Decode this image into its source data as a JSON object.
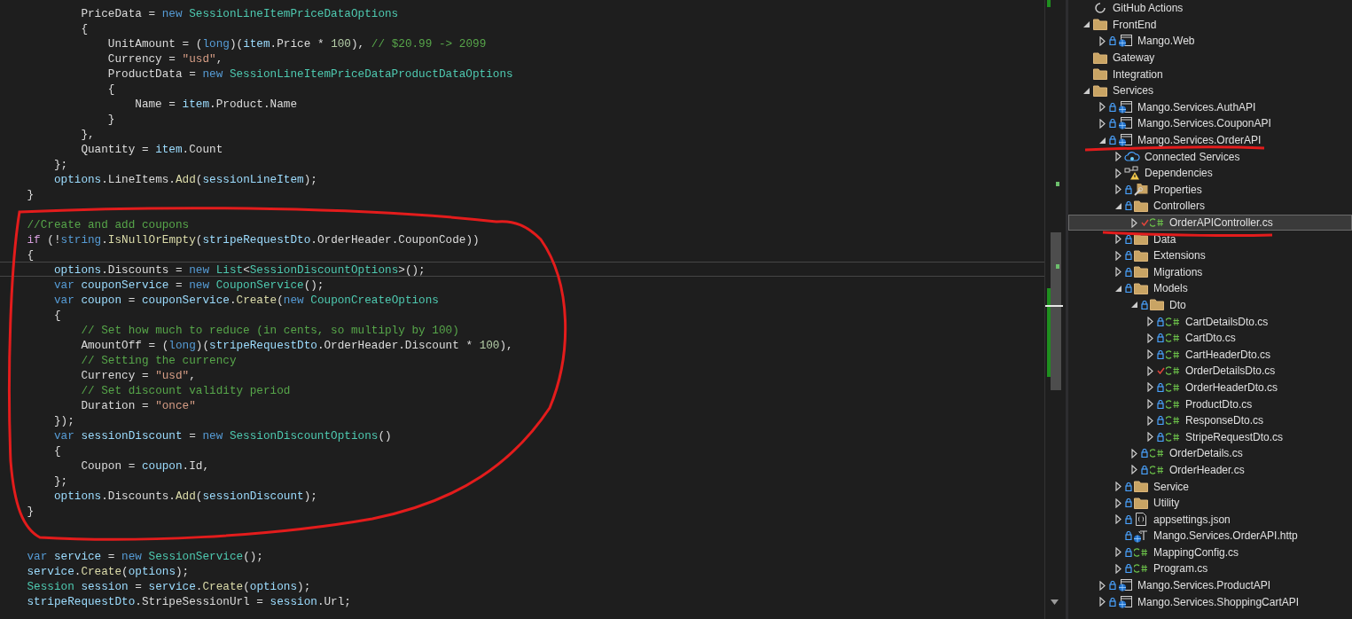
{
  "editor": {
    "lines": [
      {
        "kind": "code",
        "tokens": [
          {
            "kind": "plain",
            "text": "            PriceData = "
          },
          {
            "kind": "keyword",
            "text": "new"
          },
          {
            "kind": "type",
            "text": " SessionLineItemPriceDataOptions"
          }
        ]
      },
      {
        "kind": "code",
        "tokens": [
          {
            "kind": "plain",
            "text": "            {"
          }
        ]
      },
      {
        "kind": "code",
        "tokens": [
          {
            "kind": "plain",
            "text": "                UnitAmount = ("
          },
          {
            "kind": "keyword",
            "text": "long"
          },
          {
            "kind": "plain",
            "text": ")("
          },
          {
            "kind": "variable",
            "text": "item"
          },
          {
            "kind": "plain",
            "text": ".Price * "
          },
          {
            "kind": "number",
            "text": "100"
          },
          {
            "kind": "plain",
            "text": "), "
          },
          {
            "kind": "comment",
            "text": "// $20.99 -> 2099"
          }
        ]
      },
      {
        "kind": "code",
        "tokens": [
          {
            "kind": "plain",
            "text": "                Currency = "
          },
          {
            "kind": "string",
            "text": "\"usd\""
          },
          {
            "kind": "plain",
            "text": ","
          }
        ]
      },
      {
        "kind": "code",
        "tokens": [
          {
            "kind": "plain",
            "text": "                ProductData = "
          },
          {
            "kind": "keyword",
            "text": "new"
          },
          {
            "kind": "type",
            "text": " SessionLineItemPriceDataProductDataOptions"
          }
        ]
      },
      {
        "kind": "code",
        "tokens": [
          {
            "kind": "plain",
            "text": "                {"
          }
        ]
      },
      {
        "kind": "code",
        "tokens": [
          {
            "kind": "plain",
            "text": "                    Name = "
          },
          {
            "kind": "variable",
            "text": "item"
          },
          {
            "kind": "plain",
            "text": ".Product.Name"
          }
        ]
      },
      {
        "kind": "code",
        "tokens": [
          {
            "kind": "plain",
            "text": "                }"
          }
        ]
      },
      {
        "kind": "code",
        "tokens": [
          {
            "kind": "plain",
            "text": "            },"
          }
        ]
      },
      {
        "kind": "code",
        "tokens": [
          {
            "kind": "plain",
            "text": "            Quantity = "
          },
          {
            "kind": "variable",
            "text": "item"
          },
          {
            "kind": "plain",
            "text": ".Count"
          }
        ]
      },
      {
        "kind": "code",
        "tokens": [
          {
            "kind": "plain",
            "text": "        };"
          }
        ]
      },
      {
        "kind": "code",
        "tokens": [
          {
            "kind": "variable",
            "text": "        options"
          },
          {
            "kind": "plain",
            "text": ".LineItems."
          },
          {
            "kind": "method",
            "text": "Add"
          },
          {
            "kind": "plain",
            "text": "("
          },
          {
            "kind": "variable",
            "text": "sessionLineItem"
          },
          {
            "kind": "plain",
            "text": ");"
          }
        ]
      },
      {
        "kind": "code",
        "tokens": [
          {
            "kind": "plain",
            "text": "    }"
          }
        ]
      },
      {
        "kind": "blank"
      },
      {
        "kind": "code",
        "tokens": [
          {
            "kind": "comment",
            "text": "    //Create and add coupons"
          }
        ]
      },
      {
        "kind": "code",
        "tokens": [
          {
            "kind": "control",
            "text": "    if"
          },
          {
            "kind": "plain",
            "text": " (!"
          },
          {
            "kind": "keyword",
            "text": "string"
          },
          {
            "kind": "plain",
            "text": "."
          },
          {
            "kind": "method",
            "text": "IsNullOrEmpty"
          },
          {
            "kind": "plain",
            "text": "("
          },
          {
            "kind": "variable",
            "text": "stripeRequestDto"
          },
          {
            "kind": "plain",
            "text": ".OrderHeader.CouponCode))"
          }
        ]
      },
      {
        "kind": "code",
        "tokens": [
          {
            "kind": "plain",
            "text": "    {"
          }
        ]
      },
      {
        "kind": "code",
        "current": true,
        "tokens": [
          {
            "kind": "variable",
            "text": "        options"
          },
          {
            "kind": "plain",
            "text": ".Discounts = "
          },
          {
            "kind": "keyword",
            "text": "new"
          },
          {
            "kind": "type",
            "text": " List"
          },
          {
            "kind": "plain",
            "text": "<"
          },
          {
            "kind": "type",
            "text": "SessionDiscountOptions"
          },
          {
            "kind": "plain",
            "text": ">();"
          }
        ]
      },
      {
        "kind": "code",
        "tokens": [
          {
            "kind": "keyword",
            "text": "        var"
          },
          {
            "kind": "variable",
            "text": " couponService"
          },
          {
            "kind": "plain",
            "text": " = "
          },
          {
            "kind": "keyword",
            "text": "new"
          },
          {
            "kind": "type",
            "text": " CouponService"
          },
          {
            "kind": "plain",
            "text": "();"
          }
        ]
      },
      {
        "kind": "code",
        "tokens": [
          {
            "kind": "keyword",
            "text": "        var"
          },
          {
            "kind": "variable",
            "text": " coupon"
          },
          {
            "kind": "plain",
            "text": " = "
          },
          {
            "kind": "variable",
            "text": "couponService"
          },
          {
            "kind": "plain",
            "text": "."
          },
          {
            "kind": "method",
            "text": "Create"
          },
          {
            "kind": "plain",
            "text": "("
          },
          {
            "kind": "keyword",
            "text": "new"
          },
          {
            "kind": "type",
            "text": " CouponCreateOptions"
          }
        ]
      },
      {
        "kind": "code",
        "tokens": [
          {
            "kind": "plain",
            "text": "        {"
          }
        ]
      },
      {
        "kind": "code",
        "tokens": [
          {
            "kind": "comment",
            "text": "            // Set how much to reduce (in cents, so multiply by 100)"
          }
        ]
      },
      {
        "kind": "code",
        "tokens": [
          {
            "kind": "plain",
            "text": "            AmountOff = ("
          },
          {
            "kind": "keyword",
            "text": "long"
          },
          {
            "kind": "plain",
            "text": ")("
          },
          {
            "kind": "variable",
            "text": "stripeRequestDto"
          },
          {
            "kind": "plain",
            "text": ".OrderHeader.Discount * "
          },
          {
            "kind": "number",
            "text": "100"
          },
          {
            "kind": "plain",
            "text": "),"
          }
        ]
      },
      {
        "kind": "code",
        "tokens": [
          {
            "kind": "comment",
            "text": "            // Setting the currency"
          }
        ]
      },
      {
        "kind": "code",
        "tokens": [
          {
            "kind": "plain",
            "text": "            Currency = "
          },
          {
            "kind": "string",
            "text": "\"usd\""
          },
          {
            "kind": "plain",
            "text": ","
          }
        ]
      },
      {
        "kind": "code",
        "tokens": [
          {
            "kind": "comment",
            "text": "            // Set discount validity period"
          }
        ]
      },
      {
        "kind": "code",
        "tokens": [
          {
            "kind": "plain",
            "text": "            Duration = "
          },
          {
            "kind": "string",
            "text": "\"once\""
          }
        ]
      },
      {
        "kind": "code",
        "tokens": [
          {
            "kind": "plain",
            "text": "        });"
          }
        ]
      },
      {
        "kind": "code",
        "tokens": [
          {
            "kind": "keyword",
            "text": "        var"
          },
          {
            "kind": "variable",
            "text": " sessionDiscount"
          },
          {
            "kind": "plain",
            "text": " = "
          },
          {
            "kind": "keyword",
            "text": "new"
          },
          {
            "kind": "type",
            "text": " SessionDiscountOptions"
          },
          {
            "kind": "plain",
            "text": "()"
          }
        ]
      },
      {
        "kind": "code",
        "tokens": [
          {
            "kind": "plain",
            "text": "        {"
          }
        ]
      },
      {
        "kind": "code",
        "tokens": [
          {
            "kind": "plain",
            "text": "            Coupon = "
          },
          {
            "kind": "variable",
            "text": "coupon"
          },
          {
            "kind": "plain",
            "text": ".Id,"
          }
        ]
      },
      {
        "kind": "code",
        "tokens": [
          {
            "kind": "plain",
            "text": "        };"
          }
        ]
      },
      {
        "kind": "code",
        "tokens": [
          {
            "kind": "variable",
            "text": "        options"
          },
          {
            "kind": "plain",
            "text": ".Discounts."
          },
          {
            "kind": "method",
            "text": "Add"
          },
          {
            "kind": "plain",
            "text": "("
          },
          {
            "kind": "variable",
            "text": "sessionDiscount"
          },
          {
            "kind": "plain",
            "text": ");"
          }
        ]
      },
      {
        "kind": "code",
        "tokens": [
          {
            "kind": "plain",
            "text": "    }"
          }
        ]
      },
      {
        "kind": "blank"
      },
      {
        "kind": "blank"
      },
      {
        "kind": "code",
        "tokens": [
          {
            "kind": "keyword",
            "text": "    var"
          },
          {
            "kind": "variable",
            "text": " service"
          },
          {
            "kind": "plain",
            "text": " = "
          },
          {
            "kind": "keyword",
            "text": "new"
          },
          {
            "kind": "type",
            "text": " SessionService"
          },
          {
            "kind": "plain",
            "text": "();"
          }
        ]
      },
      {
        "kind": "code",
        "tokens": [
          {
            "kind": "variable",
            "text": "    service"
          },
          {
            "kind": "plain",
            "text": "."
          },
          {
            "kind": "method",
            "text": "Create"
          },
          {
            "kind": "plain",
            "text": "("
          },
          {
            "kind": "variable",
            "text": "options"
          },
          {
            "kind": "plain",
            "text": ");"
          }
        ]
      },
      {
        "kind": "code",
        "tokens": [
          {
            "kind": "type",
            "text": "    Session"
          },
          {
            "kind": "variable",
            "text": " session"
          },
          {
            "kind": "plain",
            "text": " = "
          },
          {
            "kind": "variable",
            "text": "service"
          },
          {
            "kind": "plain",
            "text": "."
          },
          {
            "kind": "method",
            "text": "Create"
          },
          {
            "kind": "plain",
            "text": "("
          },
          {
            "kind": "variable",
            "text": "options"
          },
          {
            "kind": "plain",
            "text": ");"
          }
        ]
      },
      {
        "kind": "code",
        "tokens": [
          {
            "kind": "variable",
            "text": "    stripeRequestDto"
          },
          {
            "kind": "plain",
            "text": ".StripeSessionUrl = "
          },
          {
            "kind": "variable",
            "text": "session"
          },
          {
            "kind": "plain",
            "text": ".Url;"
          }
        ]
      }
    ]
  },
  "solution_explorer": {
    "items": [
      {
        "label": "GitHub Actions",
        "kind": "github",
        "selected": false
      },
      {
        "label": "FrontEnd",
        "kind": "folder",
        "expanded": true,
        "selected": false,
        "children": [
          {
            "label": "Mango.Web",
            "kind": "project",
            "locked": true,
            "expanded": false,
            "selected": false
          }
        ]
      },
      {
        "label": "Gateway",
        "kind": "folder",
        "selected": false
      },
      {
        "label": "Integration",
        "kind": "folder",
        "selected": false
      },
      {
        "label": "Services",
        "kind": "folder",
        "expanded": true,
        "selected": false,
        "children": [
          {
            "label": "Mango.Services.AuthAPI",
            "kind": "project",
            "locked": true,
            "expanded": false,
            "selected": false
          },
          {
            "label": "Mango.Services.CouponAPI",
            "kind": "project",
            "locked": true,
            "expanded": false,
            "selected": false
          },
          {
            "label": "Mango.Services.OrderAPI",
            "kind": "project",
            "locked": true,
            "expanded": true,
            "selected": false,
            "children": [
              {
                "label": "Connected Services",
                "kind": "connected",
                "expanded": false,
                "selected": false
              },
              {
                "label": "Dependencies",
                "kind": "dependencies",
                "expanded": false,
                "selected": false
              },
              {
                "label": "Properties",
                "kind": "properties",
                "locked": true,
                "expanded": false,
                "selected": false
              },
              {
                "label": "Controllers",
                "kind": "folder",
                "locked": true,
                "expanded": true,
                "selected": false,
                "children": [
                  {
                    "label": "OrderAPIController.cs",
                    "kind": "csharp",
                    "locked": false,
                    "expanded": false,
                    "selected": true
                  }
                ]
              },
              {
                "label": "Data",
                "kind": "folder",
                "locked": true,
                "expanded": false,
                "selected": false
              },
              {
                "label": "Extensions",
                "kind": "folder",
                "locked": true,
                "expanded": false,
                "selected": false
              },
              {
                "label": "Migrations",
                "kind": "folder",
                "locked": true,
                "expanded": false,
                "selected": false
              },
              {
                "label": "Models",
                "kind": "folder",
                "locked": true,
                "expanded": true,
                "selected": false,
                "children": [
                  {
                    "label": "Dto",
                    "kind": "folder",
                    "locked": true,
                    "expanded": true,
                    "selected": false,
                    "children": [
                      {
                        "label": "CartDetailsDto.cs",
                        "kind": "csharp",
                        "locked": true,
                        "expanded": false,
                        "selected": false
                      },
                      {
                        "label": "CartDto.cs",
                        "kind": "csharp",
                        "locked": true,
                        "expanded": false,
                        "selected": false
                      },
                      {
                        "label": "CartHeaderDto.cs",
                        "kind": "csharp",
                        "locked": true,
                        "expanded": false,
                        "selected": false
                      },
                      {
                        "label": "OrderDetailsDto.cs",
                        "kind": "csharp",
                        "locked": false,
                        "expanded": false,
                        "selected": false
                      },
                      {
                        "label": "OrderHeaderDto.cs",
                        "kind": "csharp",
                        "locked": true,
                        "expanded": false,
                        "selected": false
                      },
                      {
                        "label": "ProductDto.cs",
                        "kind": "csharp",
                        "locked": true,
                        "expanded": false,
                        "selected": false
                      },
                      {
                        "label": "ResponseDto.cs",
                        "kind": "csharp",
                        "locked": true,
                        "expanded": false,
                        "selected": false
                      },
                      {
                        "label": "StripeRequestDto.cs",
                        "kind": "csharp",
                        "locked": true,
                        "expanded": false,
                        "selected": false
                      }
                    ]
                  },
                  {
                    "label": "OrderDetails.cs",
                    "kind": "csharp",
                    "locked": true,
                    "expanded": false,
                    "selected": false
                  },
                  {
                    "label": "OrderHeader.cs",
                    "kind": "csharp",
                    "locked": true,
                    "expanded": false,
                    "selected": false
                  }
                ]
              },
              {
                "label": "Service",
                "kind": "folder",
                "locked": true,
                "expanded": false,
                "selected": false
              },
              {
                "label": "Utility",
                "kind": "folder",
                "locked": true,
                "expanded": false,
                "selected": false
              },
              {
                "label": "appsettings.json",
                "kind": "json",
                "locked": true,
                "expanded": false,
                "selected": false
              },
              {
                "label": "Mango.Services.OrderAPI.http",
                "kind": "http",
                "locked": true,
                "selected": false
              },
              {
                "label": "MappingConfig.cs",
                "kind": "csharp",
                "locked": true,
                "expanded": false,
                "selected": false
              },
              {
                "label": "Program.cs",
                "kind": "csharp",
                "locked": true,
                "expanded": false,
                "selected": false
              }
            ]
          },
          {
            "label": "Mango.Services.ProductAPI",
            "kind": "project",
            "locked": true,
            "expanded": false,
            "selected": false
          },
          {
            "label": "Mango.Services.ShoppingCartAPI",
            "kind": "project",
            "locked": true,
            "expanded": false,
            "selected": false
          }
        ]
      }
    ]
  }
}
